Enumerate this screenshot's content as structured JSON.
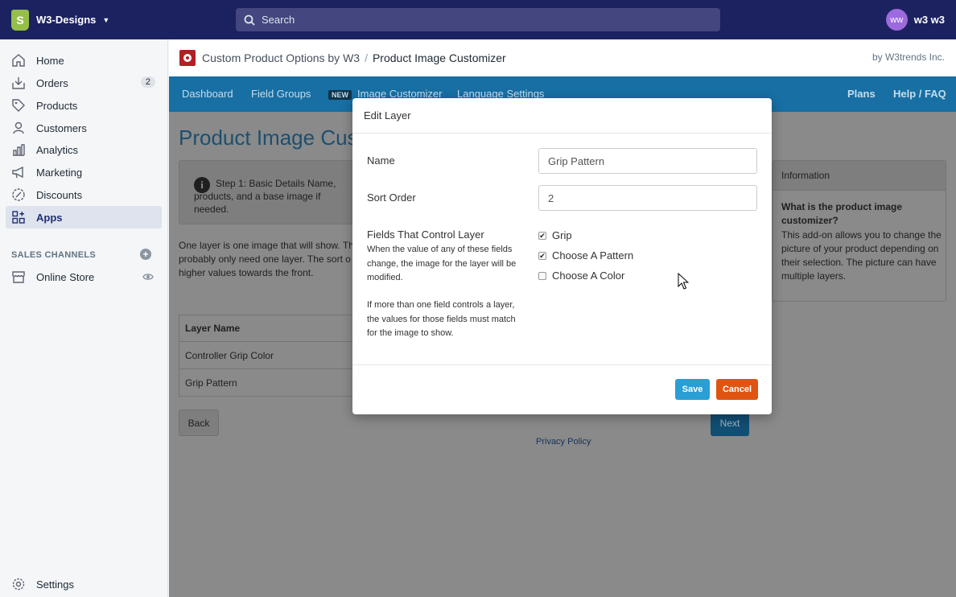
{
  "topbar": {
    "store_name": "W3-Designs",
    "search_placeholder": "Search",
    "user_initials": "ww",
    "user_name": "w3 w3"
  },
  "sidebar": {
    "items": [
      {
        "label": "Home",
        "icon": "home-icon"
      },
      {
        "label": "Orders",
        "icon": "orders-icon",
        "badge": "2"
      },
      {
        "label": "Products",
        "icon": "tag-icon"
      },
      {
        "label": "Customers",
        "icon": "person-icon"
      },
      {
        "label": "Analytics",
        "icon": "bar-chart-icon"
      },
      {
        "label": "Marketing",
        "icon": "megaphone-icon"
      },
      {
        "label": "Discounts",
        "icon": "discount-icon"
      },
      {
        "label": "Apps",
        "icon": "apps-icon",
        "active": true
      }
    ],
    "sales_channels_title": "SALES CHANNELS",
    "online_store_label": "Online Store",
    "settings_label": "Settings"
  },
  "app_header": {
    "app_name": "Custom Product Options by W3",
    "separator": "/",
    "current_page": "Product Image Customizer",
    "byline": "by W3trends Inc."
  },
  "app_nav": {
    "dashboard": "Dashboard",
    "field_groups": "Field Groups",
    "new_tag": "NEW",
    "image_customizer": "Image Customizer",
    "language_settings": "Language Settings",
    "plans": "Plans",
    "help": "Help / FAQ"
  },
  "page": {
    "title": "Product Image Cus",
    "step_text": "Step 1: Basic Details Name, products, and a base image if needed.",
    "description": "One layer is one image that will show. Th probably only need one layer. The sort o higher values towards the front.",
    "table_header": "Layer Name",
    "layers": [
      "Controller Grip Color",
      "Grip Pattern"
    ],
    "back_label": "Back",
    "next_label": "Next",
    "privacy_label": "Privacy Policy"
  },
  "info_panel": {
    "title": "Information",
    "question": "What is the product image customizer?",
    "answer": "This add-on allows you to change the picture of your product depending on their selection. The picture can have multiple layers."
  },
  "modal": {
    "title": "Edit Layer",
    "name_label": "Name",
    "name_value": "Grip Pattern",
    "sort_label": "Sort Order",
    "sort_value": "2",
    "fields_label": "Fields That Control Layer",
    "help_1": "When the value of any of these fields change, the image for the layer will be modified.",
    "help_2": "If more than one field controls a layer, the values for those fields must match for the image to show.",
    "checkboxes": [
      {
        "label": "Grip",
        "checked": true
      },
      {
        "label": "Choose A Pattern",
        "checked": true
      },
      {
        "label": "Choose A Color",
        "checked": false
      }
    ],
    "save_label": "Save",
    "cancel_label": "Cancel"
  },
  "colors": {
    "topbar": "#1c2260",
    "appnav": "#176fa3",
    "save": "#2a9fd6",
    "cancel": "#e05412"
  }
}
